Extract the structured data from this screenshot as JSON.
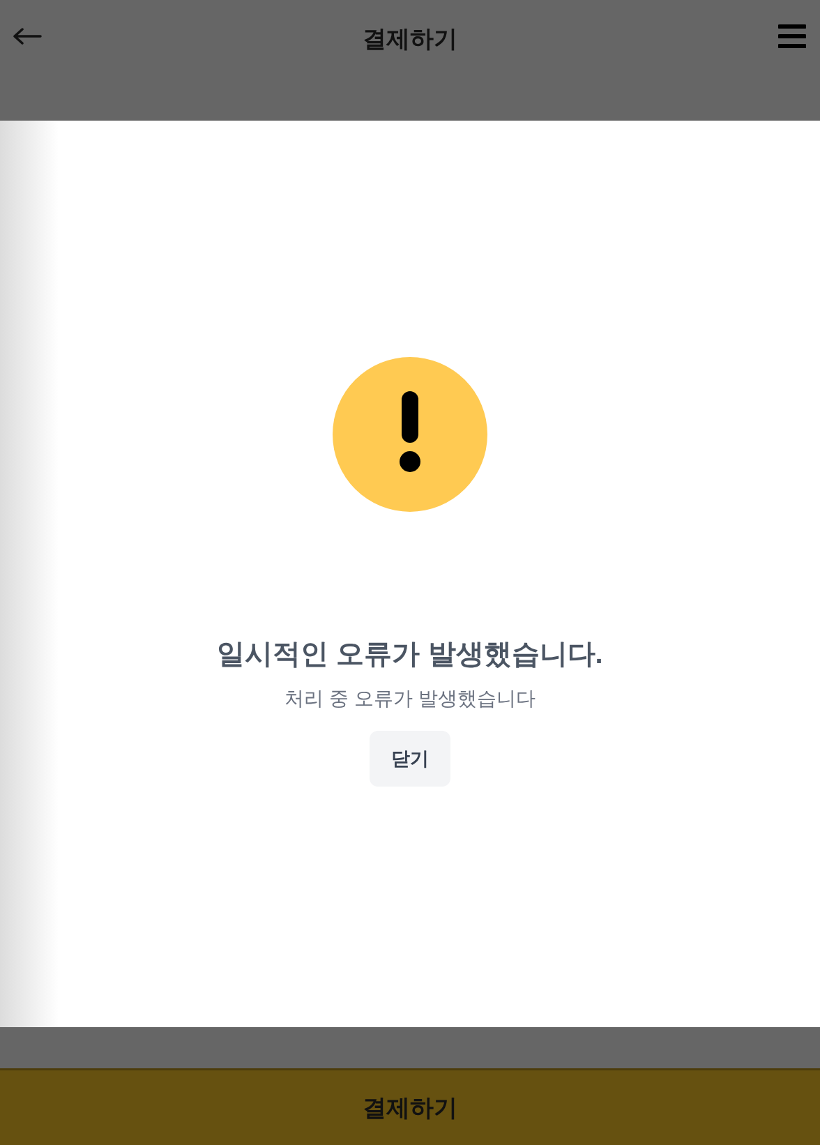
{
  "header": {
    "title": "결제하기"
  },
  "dialog": {
    "title": "일시적인 오류가 발생했습니다.",
    "message": "처리 중 오류가 발생했습니다",
    "button": "닫기"
  },
  "footer": {
    "button": "결제하기"
  }
}
